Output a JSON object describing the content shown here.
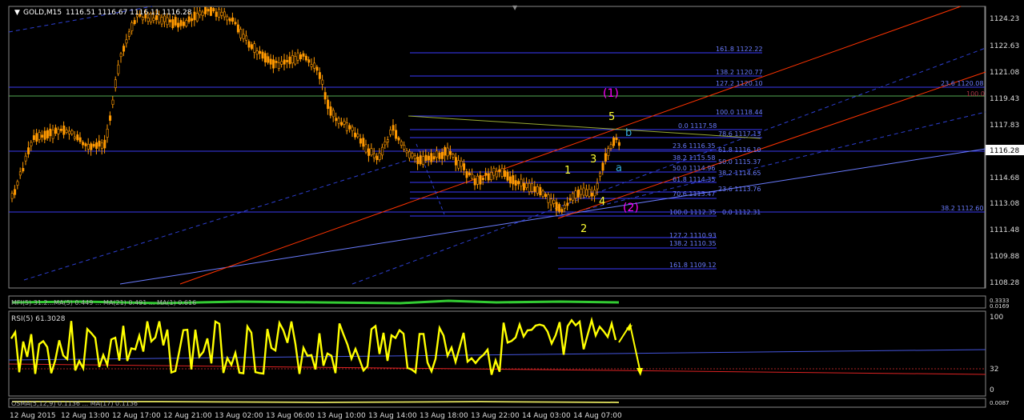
{
  "main_panel": {
    "title": "GOLD,M15",
    "ohlc": "1116.51 1116.67 1116.11 1116.28",
    "current_price_label": "1116.28",
    "price_axis": [
      "1124.23",
      "1122.63",
      "1121.08",
      "1119.43",
      "1117.83",
      "1114.68",
      "1113.08",
      "1111.48",
      "1109.88",
      "1108.28"
    ],
    "fib_levels": [
      "161.8 1122.22",
      "138.2 1120.77",
      "127.2 1120.10",
      "100.0 1118.44",
      "0.0 1117.58",
      "78.6 1117.13",
      "23.6 1116.35",
      "61.8 1116.10",
      "38.2 1115.58",
      "50.0 1115.37",
      "50.0 1114.96",
      "38.2 1114.65",
      "61.8 1114.35",
      "23.6 1113.76",
      "70.6 1113.47",
      "100.0 1112.35",
      "0.0 1112.31",
      "127.2 1110.93",
      "138.2 1110.35",
      "161.8 1109.12",
      "23.6 1120.08",
      "100.0",
      "38.2 1112.60"
    ],
    "wave_labels": {
      "w1": "(1)",
      "w2": "(2)",
      "n1": "1",
      "n2": "2",
      "n3": "3",
      "n4": "4",
      "n5": "5",
      "a": "a",
      "b": "b"
    }
  },
  "indicator_strip": {
    "label": "MFI(5) 31.2...MA(5) 0.449 ... MA(21) 0.491 ... MA(1) 0.616",
    "scale_top": "0.3333",
    "scale_bottom": "0.0169"
  },
  "rsi_panel": {
    "title": "RSI(5) 61.3028",
    "scale": [
      "100",
      "32",
      "0"
    ]
  },
  "bottom_strip": {
    "label": "OSMA(5,12,9) 0.1136 ... MA(17) 0.1136",
    "scale": "0.0087"
  },
  "time_axis": [
    "12 Aug 2015",
    "12 Aug 13:00",
    "12 Aug 17:00",
    "12 Aug 21:00",
    "13 Aug 02:00",
    "13 Aug 06:00",
    "13 Aug 10:00",
    "13 Aug 14:00",
    "13 Aug 18:00",
    "13 Aug 22:00",
    "14 Aug 03:00",
    "14 Aug 07:00"
  ],
  "colors": {
    "up": "#000000",
    "down": "#ff9900",
    "bull_fill": "#000000",
    "wick": "#ff9900",
    "trend": "#ff3300",
    "fib": "#5b6bff",
    "rsi": "#ffff00",
    "magenta": "#ff00ff"
  }
}
